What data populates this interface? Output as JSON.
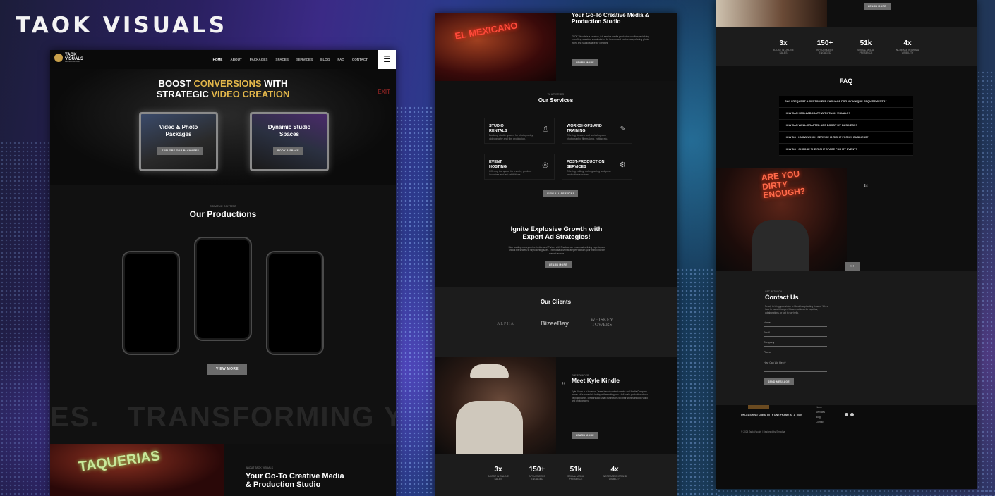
{
  "brand_title": "TAOK VISUALS",
  "site": {
    "logo_line1": "TAOK",
    "logo_line2": "VISUALS",
    "logo_line3": "MEDIA COMPANY",
    "nav": [
      "HOME",
      "ABOUT",
      "PACKAGES",
      "SPACES",
      "SERVICES",
      "BLOG",
      "FAQ",
      "CONTACT"
    ],
    "menu_icon": "☰"
  },
  "hero": {
    "line1_a": "BOOST ",
    "line1_b": "CONVERSIONS",
    " line1_c": "",
    "line1_c2": " WITH",
    "line2_a": "STRATEGIC ",
    "line2_b": "VIDEO CREATION",
    "exit_sign": "EXIT",
    "card1_title": "Video & Photo Packages",
    "card1_btn": "EXPLORE OUR PACKAGES",
    "card2_title": "Dynamic Studio Spaces",
    "card2_btn": "BOOK A SPACE"
  },
  "productions": {
    "eyebrow": "CREATIVE CONTENT",
    "title": "Our Productions",
    "btn": "VIEW MORE",
    "marquee": "ES.   TRANSFORMING YOUR"
  },
  "about": {
    "eyebrow": "ABOUT TAOK VISUALS",
    "title": "Your Go-To Creative Media & Production Studio",
    "neon1": "TAQUERIAS",
    "neon2": "EL MEXICANO",
    "body": "TAOK Visuals is a creative, full-service media production studio specializing in crafting standout visual stories for brands and businesses, offering photo, video and studio space for creators.",
    "btn": "LEARN MORE"
  },
  "services": {
    "eyebrow": "WHAT WE DO",
    "title": "Our Services",
    "items": [
      {
        "title": "STUDIO RENTALS",
        "desc": "Booking studio spaces for photography, videography and film production.",
        "icon": "camera-icon",
        "glyph": "⎙"
      },
      {
        "title": "WORKSHOPS AND TRAINING",
        "desc": "Offering classes and workshops on photography, filmmaking, editing etc.",
        "icon": "palette-icon",
        "glyph": "✎"
      },
      {
        "title": "EVENT HOSTING",
        "desc": "Offering the space for events, product launches and art exhibitions.",
        "icon": "target-icon",
        "glyph": "◎"
      },
      {
        "title": "POST-PRODUCTION SERVICES",
        "desc": "Offering editing, color grading and post-production services.",
        "icon": "tools-icon",
        "glyph": "⚙"
      }
    ],
    "btn": "VIEW ALL SERVICES"
  },
  "ads": {
    "title": "Ignite Explosive Growth with Expert Ad Strategies!",
    "body": "Stop wasting money on ineffective ads! Partner with Shadow, our proven advertising experts, and unlock the secrets to skyrocketing sales. Their data-driven strategies will turn your brand into the market favorite.",
    "btn": "LEARN MORE"
  },
  "clients": {
    "title": "Our Clients",
    "logos": [
      "ALPHA",
      "BizeeBay",
      "WHISKEY TOWERS"
    ]
  },
  "founder": {
    "eyebrow": "THE FOUNDER",
    "title": "Meet Kyle Kindle",
    "body": "Kyle Kindle is a Houston, Texas-based content creator and Media Company owner. He's turned his hobby of filmmaking into a full-scale production studio helping brands, creators and small businesses tell their stories through video and photography.",
    "btn": "LEARN MORE"
  },
  "stats": [
    {
      "n": "3x",
      "l": "BOOST IN ONLINE SALES"
    },
    {
      "n": "150+",
      "l": "INFLUENCERS ENGAGED"
    },
    {
      "n": "51k",
      "l": "SOCIAL MEDIA PRESENCE"
    },
    {
      "n": "4x",
      "l": "INCREASE IN BRAND VISIBILITY"
    }
  ],
  "faq": {
    "title": "FAQ",
    "items": [
      "CAN I REQUEST A CUSTOMIZED PACKAGE FOR MY UNIQUE REQUIREMENTS?",
      "HOW CAN I COLLABORATE WITH TAOK VISUALS?",
      "HOW CAN WELL-CRAFTED ADS BOOST MY BUSINESS?",
      "HOW DO I KNOW WHICH SERVICE IS RIGHT FOR MY BUSINESS?",
      "HOW DO I CHOOSE THE RIGHT SPACE FOR MY EVENT?"
    ]
  },
  "testimonial": {
    "neon": "ARE YOU DIRTY ENOUGH?",
    "quote_mark": "“",
    "pager": "‹ ›"
  },
  "contact": {
    "eyebrow": "GET IN TOUCH",
    "title": "Contact Us",
    "body": "Ready to bring your vision to life with captivating visuals? We're here to make it happen! Reach out to us for inquiries, collaborations, or just to say hello.",
    "fields": [
      "Name",
      "Email",
      "Company",
      "Phone",
      "How Can We Help?"
    ],
    "btn": "SEND MESSAGE"
  },
  "footer": {
    "tagline": "UNLEASHING CREATIVITY ONE FRAME AT A TIME",
    "links": [
      "Home",
      "Services",
      "Blog",
      "Contact"
    ],
    "copyright": "© 2024 Taok Visuals | Designed by Shradha"
  }
}
